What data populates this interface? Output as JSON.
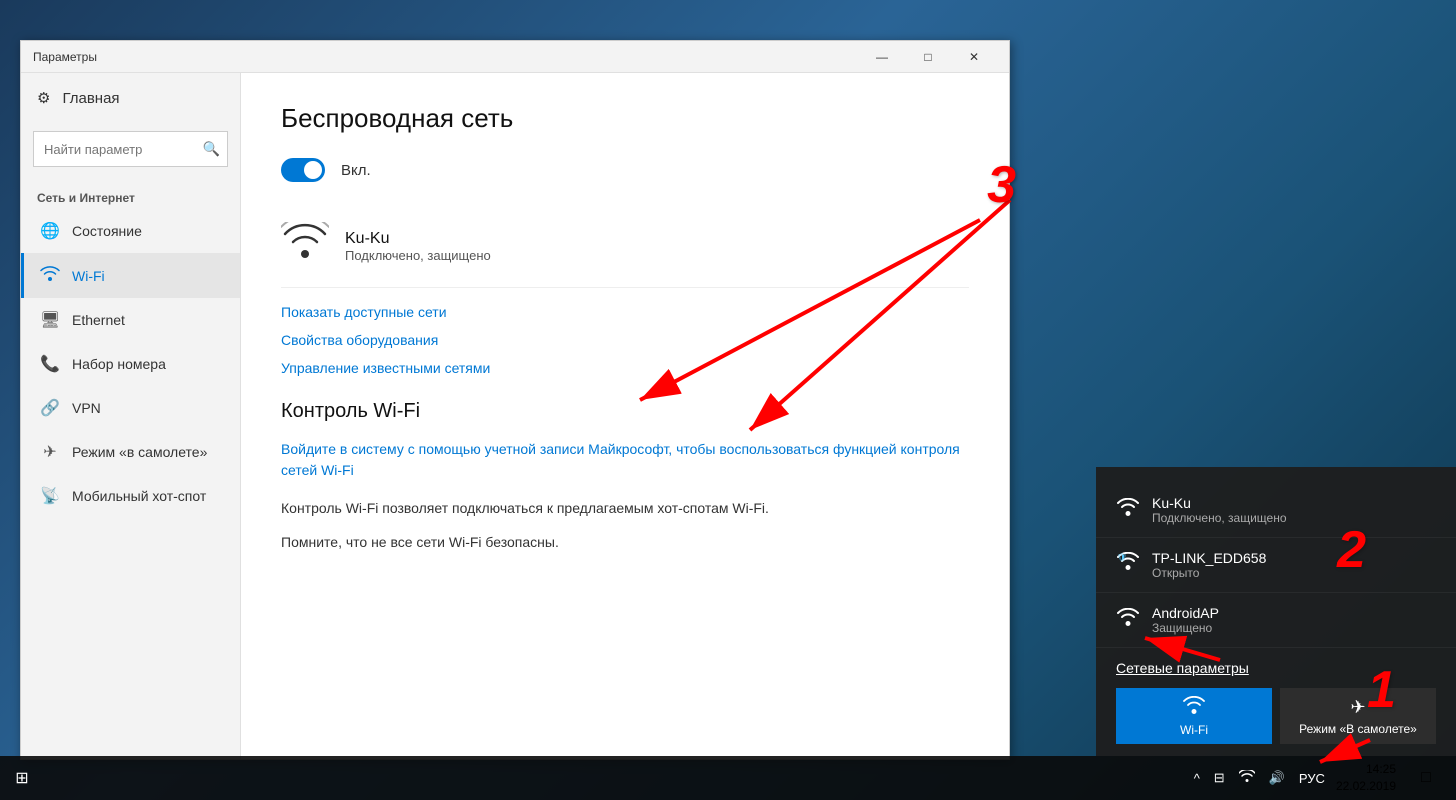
{
  "window": {
    "title": "Параметры",
    "controls": {
      "minimize": "—",
      "maximize": "□",
      "close": "✕"
    }
  },
  "sidebar": {
    "home_label": "Главная",
    "search_placeholder": "Найти параметр",
    "section_label": "Сеть и Интернет",
    "items": [
      {
        "id": "status",
        "label": "Состояние",
        "icon": "🌐"
      },
      {
        "id": "wifi",
        "label": "Wi-Fi",
        "icon": "📶",
        "active": true
      },
      {
        "id": "ethernet",
        "label": "Ethernet",
        "icon": "🖥"
      },
      {
        "id": "dialup",
        "label": "Набор номера",
        "icon": "📞"
      },
      {
        "id": "vpn",
        "label": "VPN",
        "icon": "🔗"
      },
      {
        "id": "airplane",
        "label": "Режим «в самолете»",
        "icon": "✈"
      },
      {
        "id": "hotspot",
        "label": "Мобильный хот-спот",
        "icon": "📡"
      }
    ]
  },
  "main": {
    "title": "Беспроводная сеть",
    "toggle_label": "Вкл.",
    "connected_network": {
      "name": "Ku-Ku",
      "status": "Подключено, защищено"
    },
    "links": {
      "show_networks": "Показать доступные сети",
      "adapter_properties": "Свойства оборудования",
      "manage_networks": "Управление известными сетями"
    },
    "wifi_sense": {
      "heading": "Контроль Wi-Fi",
      "sign_in_link": "Войдите в систему с помощью учетной записи Майкрософт, чтобы воспользоваться функцией контроля сетей Wi-Fi",
      "description1": "Контроль Wi-Fi позволяет подключаться к предлагаемым хот-спотам Wi-Fi.",
      "description2": "Помните, что не все сети Wi-Fi безопасны."
    }
  },
  "flyout": {
    "networks": [
      {
        "name": "Ku-Ku",
        "status": "Подключено, защищено",
        "connected": true,
        "icon": "wifi"
      },
      {
        "name": "TP-LINK_EDD658",
        "status": "Открыто",
        "connected": false,
        "icon": "wifi-lock"
      },
      {
        "name": "AndroidAP",
        "status": "Защищено",
        "connected": false,
        "icon": "wifi"
      }
    ],
    "settings_link": "Сетевые параметры",
    "buttons": [
      {
        "id": "wifi-btn",
        "label": "Wi-Fi",
        "icon": "📶"
      },
      {
        "id": "airplane-btn",
        "label": "Режим «В самолете»",
        "icon": "✈"
      }
    ]
  },
  "taskbar": {
    "time": "14:25",
    "date": "22.02.2019",
    "language": "РУС",
    "icons": [
      "^",
      "⊟",
      "📶",
      "🔊"
    ]
  },
  "annotations": {
    "num1": "1",
    "num2": "2",
    "num3": "3"
  }
}
